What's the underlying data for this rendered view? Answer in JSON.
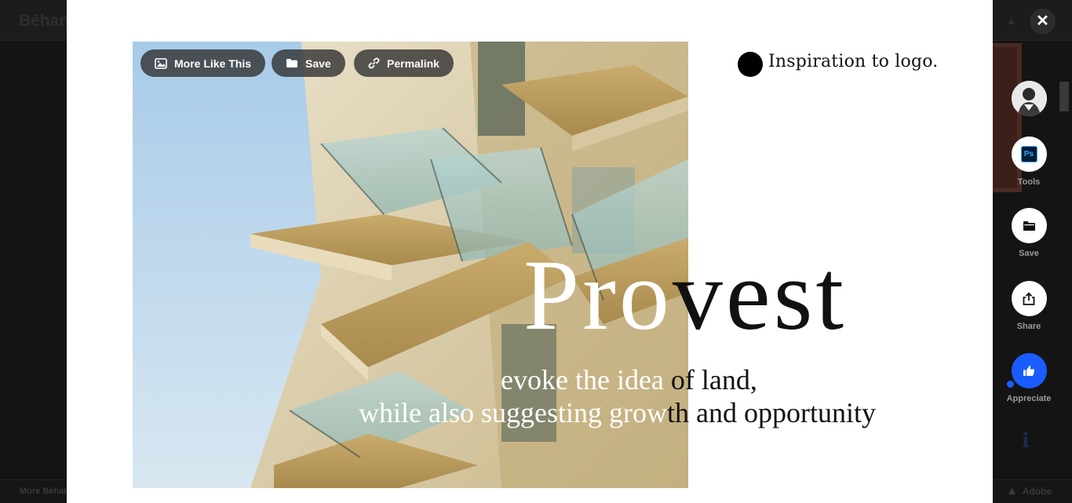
{
  "background": {
    "brand": "Bēhance",
    "adobe_top": "Adobe",
    "adobe_bottom": "Adobe",
    "more_link": "More Behance"
  },
  "toolbar": {
    "more_like_this": "More Like This",
    "save": "Save",
    "permalink": "Permalink"
  },
  "artwork": {
    "inspiration": "Inspiration to logo.",
    "title_dark": "Pro",
    "title_light": "vest",
    "tagline1_white": "evoke the idea ",
    "tagline1_dark": "of land,",
    "tagline2_white": "while also suggesting grow",
    "tagline2_dark": "th and opportunity"
  },
  "close": {
    "symbol": "✕"
  },
  "sidebar": {
    "tools_label": "Tools",
    "tools_badge": "Ps",
    "save_label": "Save",
    "share_label": "Share",
    "appreciate_label": "Appreciate",
    "info_symbol": "i"
  },
  "colors": {
    "accent": "#1a5cff",
    "pill_bg": "#2d2d2d",
    "backdrop": "#141414",
    "ps_blue": "#31a8ff"
  },
  "icons": {
    "more_like_this": "image-icon",
    "save": "folder-icon",
    "permalink": "link-icon",
    "share": "share-icon",
    "appreciate": "thumbs-up-icon",
    "close": "close-icon"
  }
}
